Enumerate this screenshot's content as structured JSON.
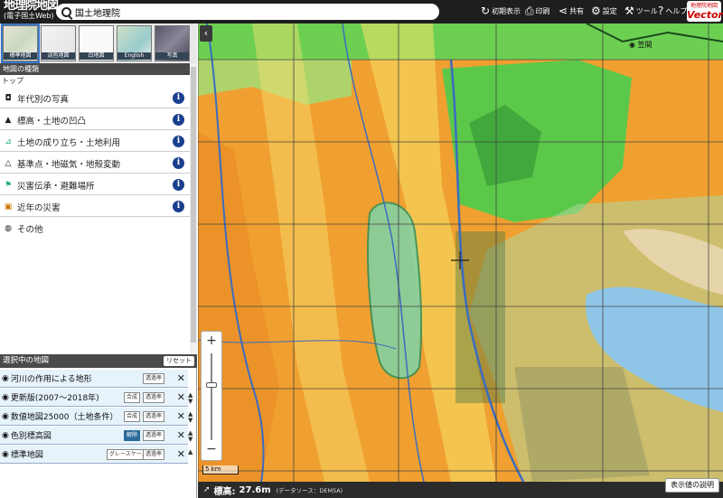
{
  "app": {
    "title": "地理院地図",
    "subtitle": "(電子国土Web)"
  },
  "search": {
    "value": "国土地理院"
  },
  "toolbar": {
    "init": "初期表示",
    "print": "印刷",
    "share": "共有",
    "settings": "設定",
    "tools": "ツール",
    "help": "ヘルプ"
  },
  "vector": {
    "top": "地理院地図",
    "label": "Vector"
  },
  "thumbs": [
    "標準地図",
    "淡色地図",
    "白地図",
    "English",
    "写真"
  ],
  "map_types": {
    "title": "地図の種類",
    "breadcrumb": "トップ",
    "items": [
      {
        "label": "年代別の写真",
        "icon": "camera-icon"
      },
      {
        "label": "標高・土地の凹凸",
        "icon": "mountain-icon"
      },
      {
        "label": "土地の成り立ち・土地利用",
        "icon": "land-icon"
      },
      {
        "label": "基準点・地磁気・地殻変動",
        "icon": "triangle-icon"
      },
      {
        "label": "災害伝承・避難場所",
        "icon": "evacuation-icon"
      },
      {
        "label": "近年の災害",
        "icon": "disaster-icon"
      },
      {
        "label": "その他",
        "icon": "globe-icon"
      }
    ]
  },
  "selected": {
    "title": "選択中の地図",
    "reset": "リセット",
    "layers": [
      {
        "label": "河川の作用による地形",
        "chips": [
          "透過率"
        ]
      },
      {
        "label": "更新版(2007〜2018年)",
        "chips": [
          "合成",
          "透過率"
        ]
      },
      {
        "label": "数値地図25000（土地条件）",
        "chips": [
          "合成",
          "透過率"
        ]
      },
      {
        "label": "色別標高図",
        "chips": [
          "解除",
          "透過率"
        ]
      },
      {
        "label": "標準地図",
        "chips": [
          "グレースケール",
          "透過率"
        ]
      }
    ]
  },
  "map": {
    "place": "笠間",
    "scale": "5 km",
    "info_i": "i"
  },
  "footer": {
    "elev_label": "標高:",
    "elev_value": "27.6m",
    "source": "(データソース：DEM5A)",
    "legend_button": "表示値の説明"
  },
  "colors": {
    "header": "#1e1e1e",
    "info": "#1b3f8f",
    "orange": "#f0a030",
    "green": "#5cc84a"
  }
}
